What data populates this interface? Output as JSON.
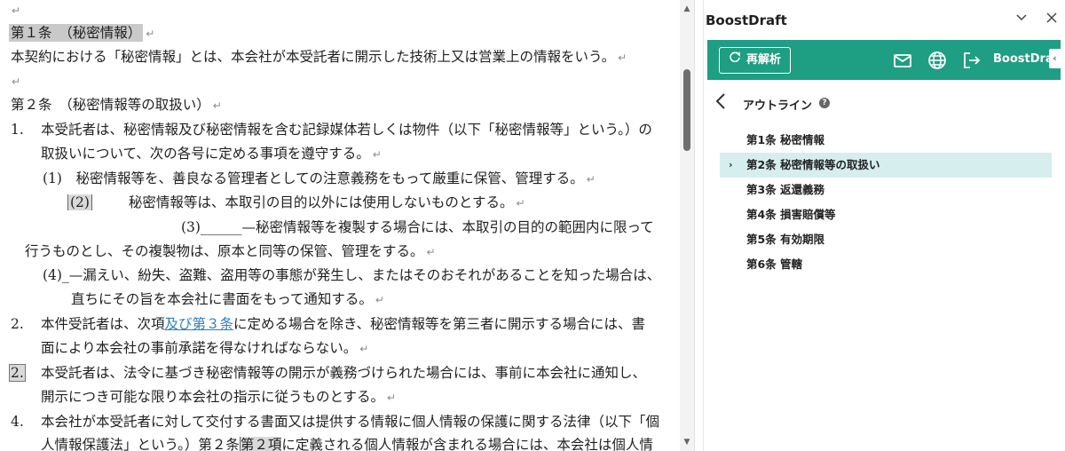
{
  "document": {
    "empty_mark": "↵",
    "article1_title": "第１条　（秘密情報）",
    "article1_body": "本契約における「秘密情報」とは、本会社が本受託者に開示した技術上又は営業上の情報をいう。",
    "article2_title": "第２条　（秘密情報等の取扱い）",
    "p1_num": "1.",
    "p1_line1": "本受託者は、秘密情報及び秘密情報を含む記録媒体若しくは物件（以下「秘密情報等」という。）の",
    "p1_line2": "取扱いについて、次の各号に定める事項を遵守する。",
    "sub1": "(1)　秘密情報等を、善良なる管理者としての注意義務をもって厳重に保管、管理する。",
    "sub2_num": "(2)",
    "sub2_text": "秘密情報等は、本取引の目的以外には使用しないものとする。",
    "sub3_line1": "(3)______—秘密情報等を複製する場合には、本取引の目的の範囲内に限って",
    "sub3_line2": "行うものとし、その複製物は、原本と同等の保管、管理をする。",
    "sub4_line1": "(4)_—漏えい、紛失、盗難、盗用等の事態が発生し、またはそのおそれがあることを知った場合は、",
    "sub4_line2": "直ちにその旨を本会社に書面をもって通知する。",
    "p2_num": "2.",
    "p2_line1_a": "本件受託者は、次項",
    "p2_line1_link": "及び第３条",
    "p2_line1_b": "に定める場合を除き、秘密情報等を第三者に開示する場合には、書",
    "p2_line2": "面により本会社の事前承諾を得なければならない。",
    "p3_num": "2.",
    "p3_line1": "本受託者は、法令に基づき秘密情報等の開示が義務づけられた場合には、事前に本会社に通知し、",
    "p3_line2": "開示につき可能な限り本会社の指示に従うものとする。",
    "p4_num": "4.",
    "p4_line1": "本会社が本受託者に対して交付する書面又は提供する情報に個人情報の保護に関する法律（以下「個",
    "p4_line2_a": "人情報保護法」という。）第２条",
    "p4_line2_hl": "第２項",
    "p4_line2_b": "に定義される個人情報が含まれる場合には、本会社は個人情"
  },
  "panel": {
    "title": "BoostDraft",
    "reanalyze_label": "再解析",
    "brand_label": "BoostDraft",
    "outline_title": "アウトライン",
    "help_label": "?",
    "collapse_label": "‹",
    "outline_items": [
      {
        "label": "第1条 秘密情報",
        "active": false
      },
      {
        "label": "第2条 秘密情報等の取扱い",
        "active": true
      },
      {
        "label": "第3条 返還義務",
        "active": false
      },
      {
        "label": "第4条 損害賠償等",
        "active": false
      },
      {
        "label": "第5条 有効期限",
        "active": false
      },
      {
        "label": "第6条 管轄",
        "active": false
      }
    ],
    "active_caret": "›"
  },
  "colors": {
    "accent": "#1e9e82",
    "active_row": "#d6eeee",
    "link": "#2f7fc1"
  }
}
